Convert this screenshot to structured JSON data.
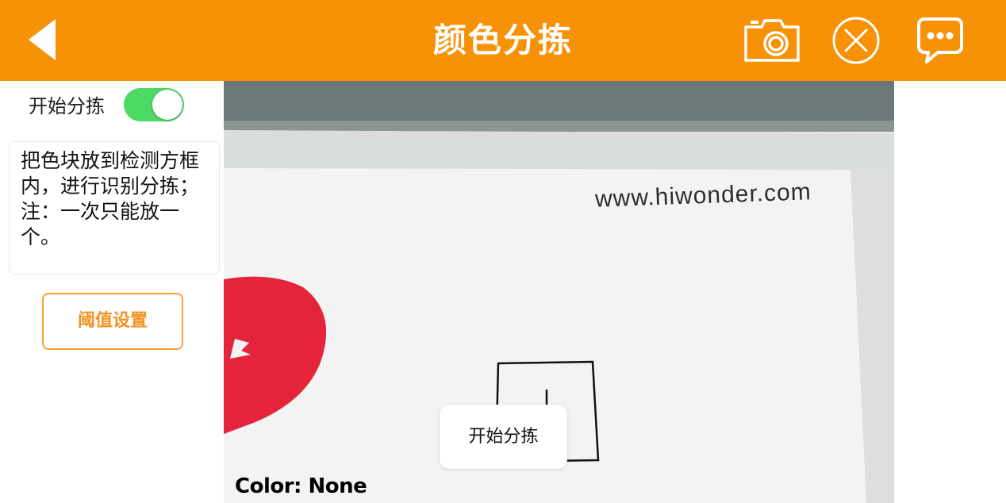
{
  "header": {
    "title": "颜色分拣",
    "background": "#f79206",
    "icons": [
      "back-arrow-icon",
      "camera-icon",
      "close-circle-icon",
      "chat-bubble-icon"
    ]
  },
  "sidebar": {
    "toggle_label": "开始分拣",
    "toggle_on": true,
    "toggle_color": "#4cd964",
    "instructions": "把色块放到检测方框内，进行识别分拣；注：一次只能放一个。",
    "threshold_button": "阈值设置",
    "accent": "#f39322"
  },
  "camera": {
    "watermark": "www.hiwonder.com",
    "color_readout": "Color: None"
  },
  "toast": {
    "message": "开始分拣"
  }
}
